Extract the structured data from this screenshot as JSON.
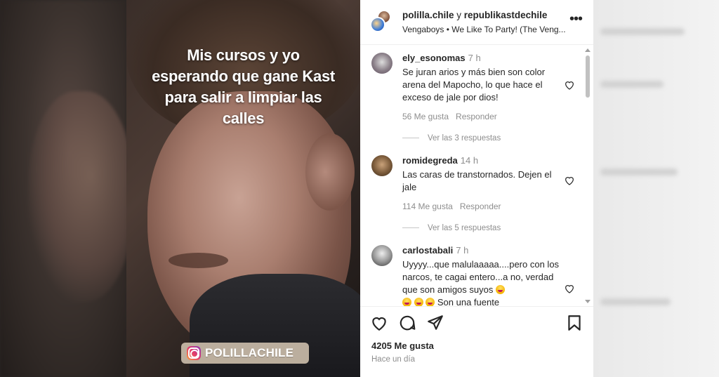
{
  "video": {
    "caption": "Mis cursos y yo esperando que gane Kast para salir a limpiar las calles",
    "watermark": "POLILLACHILE"
  },
  "header": {
    "user1": "polilla.chile",
    "connector": " y ",
    "user2": "republikastdechile",
    "audio": "Vengaboys • We Like To Party! (The Veng..."
  },
  "comments": [
    {
      "user": "ely_esonomas",
      "time": "7 h",
      "text": "Se juran arios y más bien son color arena del Mapocho, lo que hace el exceso de jale por dios!",
      "likes": "56 Me gusta",
      "reply": "Responder",
      "view_replies": "Ver las 3 respuestas"
    },
    {
      "user": "romidegreda",
      "time": "14 h",
      "text": "Las caras de transtornados. Dejen el jale",
      "likes": "114 Me gusta",
      "reply": "Responder",
      "view_replies": "Ver las 5 respuestas"
    },
    {
      "user": "carlostabali",
      "time": "7 h",
      "text": "Uyyyy...que malulaaaaa....pero con los narcos, te cagai entero...a no, verdad que son amigos suyos",
      "text_end": "Son una fuente"
    }
  ],
  "footer": {
    "likes": "4205 Me gusta",
    "time_ago": "Hace un día"
  },
  "colors": {
    "text": "#262626",
    "muted": "#8e8e8e"
  }
}
